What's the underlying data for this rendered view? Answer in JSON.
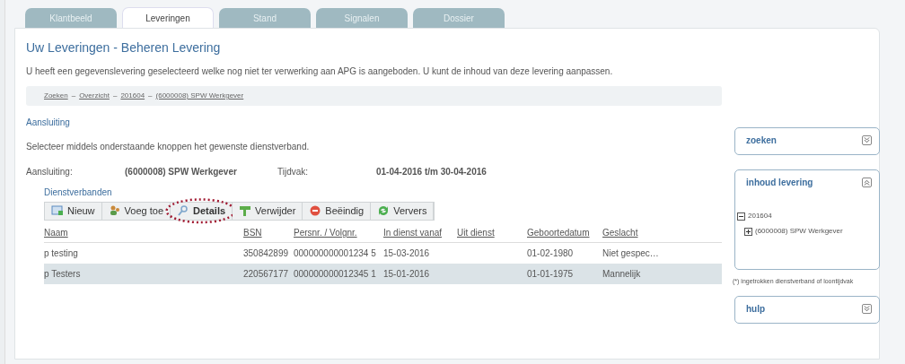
{
  "tabs": [
    {
      "label": "Klantbeeld",
      "selected": false
    },
    {
      "label": "Leveringen",
      "selected": true
    },
    {
      "label": "Stand",
      "selected": false
    },
    {
      "label": "Signalen",
      "selected": false
    },
    {
      "label": "Dossier",
      "selected": false
    }
  ],
  "page": {
    "title": "Uw Leveringen - Beheren Levering",
    "description": "U heeft een gegevenslevering geselecteerd welke nog niet ter verwerking aan APG is aangeboden. U kunt de inhoud van deze levering aanpassen."
  },
  "breadcrumb": {
    "separator": "–",
    "items": [
      "Zoeken",
      "Overzicht",
      "201604",
      "(6000008) SPW Werkgever"
    ]
  },
  "section": {
    "title": "Aansluiting",
    "instruction": "Selecteer middels onderstaande knoppen het gewenste dienstverband.",
    "fields": [
      {
        "label": "Aansluiting:",
        "value": "(6000008) SPW Werkgever"
      },
      {
        "label": "Tijdvak:",
        "value": "01-04-2016 t/m 30-04-2016"
      }
    ]
  },
  "dienstverbanden": {
    "title": "Dienstverbanden",
    "toolbar": [
      {
        "label": "Nieuw",
        "highlighted": false
      },
      {
        "label": "Voeg toe",
        "highlighted": false
      },
      {
        "label": "Details",
        "highlighted": true
      },
      {
        "label": "Verwijder",
        "highlighted": false
      },
      {
        "label": "Beëindig",
        "highlighted": false
      },
      {
        "label": "Ververs",
        "highlighted": false
      }
    ],
    "columns": [
      "Naam",
      "BSN",
      "Persnr. / Volgnr.",
      "In dienst vanaf",
      "Uit dienst",
      "Geboortedatum",
      "Geslacht"
    ],
    "rows": [
      {
        "cells": [
          "p testing",
          "350842899",
          "000000000001234 5",
          "15-03-2016",
          "",
          "01-02-1980",
          "Niet gespec…"
        ],
        "selected": false
      },
      {
        "cells": [
          "p Testers",
          "220567177",
          "000000000012345 1",
          "15-01-2016",
          "",
          "01-01-1975",
          "Mannelijk"
        ],
        "selected": true
      }
    ]
  },
  "sidebar": {
    "panels": [
      {
        "title": "zoeken",
        "expanded": false
      },
      {
        "title": "inhoud levering",
        "expanded": true,
        "tree": [
          {
            "label": "201604",
            "expanded": true,
            "children": [
              {
                "label": "(6000008) SPW Werkgever",
                "expanded": false
              }
            ]
          }
        ]
      },
      {
        "title": "hulp",
        "expanded": false
      }
    ],
    "footnote": "(*) ingetrokken dienstverband of loontijdvak"
  }
}
